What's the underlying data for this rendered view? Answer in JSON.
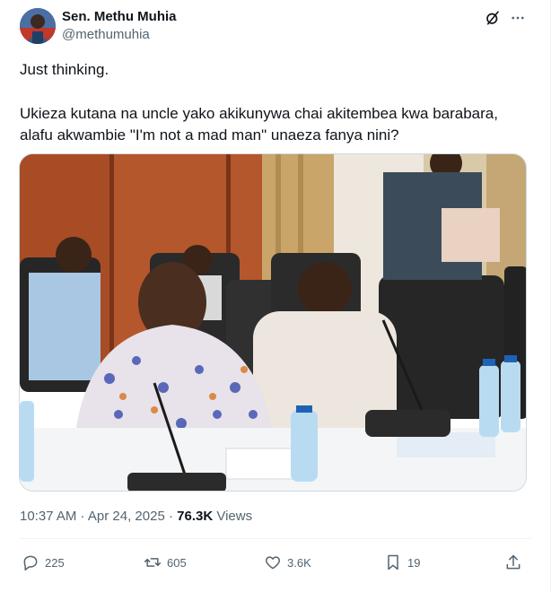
{
  "author": {
    "name": "Sen. Methu Muhia",
    "handle": "@methumuhia"
  },
  "header_icons": [
    "grok-icon",
    "more-icon"
  ],
  "tweet": {
    "line1": "Just thinking.",
    "line2": "Ukieza kutana na uncle yako akikunywa chai akitembea kwa barabara,",
    "line3": "alafu akwambie \"I'm not a mad man\" unaeza fanya nini?"
  },
  "meta": {
    "time": "10:37 AM",
    "date": "Apr 24, 2025",
    "views_count": "76.3K",
    "views_label": "Views"
  },
  "actions": {
    "replies": "225",
    "reposts": "605",
    "likes": "3.6K",
    "bookmarks": "19"
  },
  "colors": {
    "text_primary": "#0f1419",
    "text_secondary": "#536471",
    "divider": "#eff3f4"
  }
}
